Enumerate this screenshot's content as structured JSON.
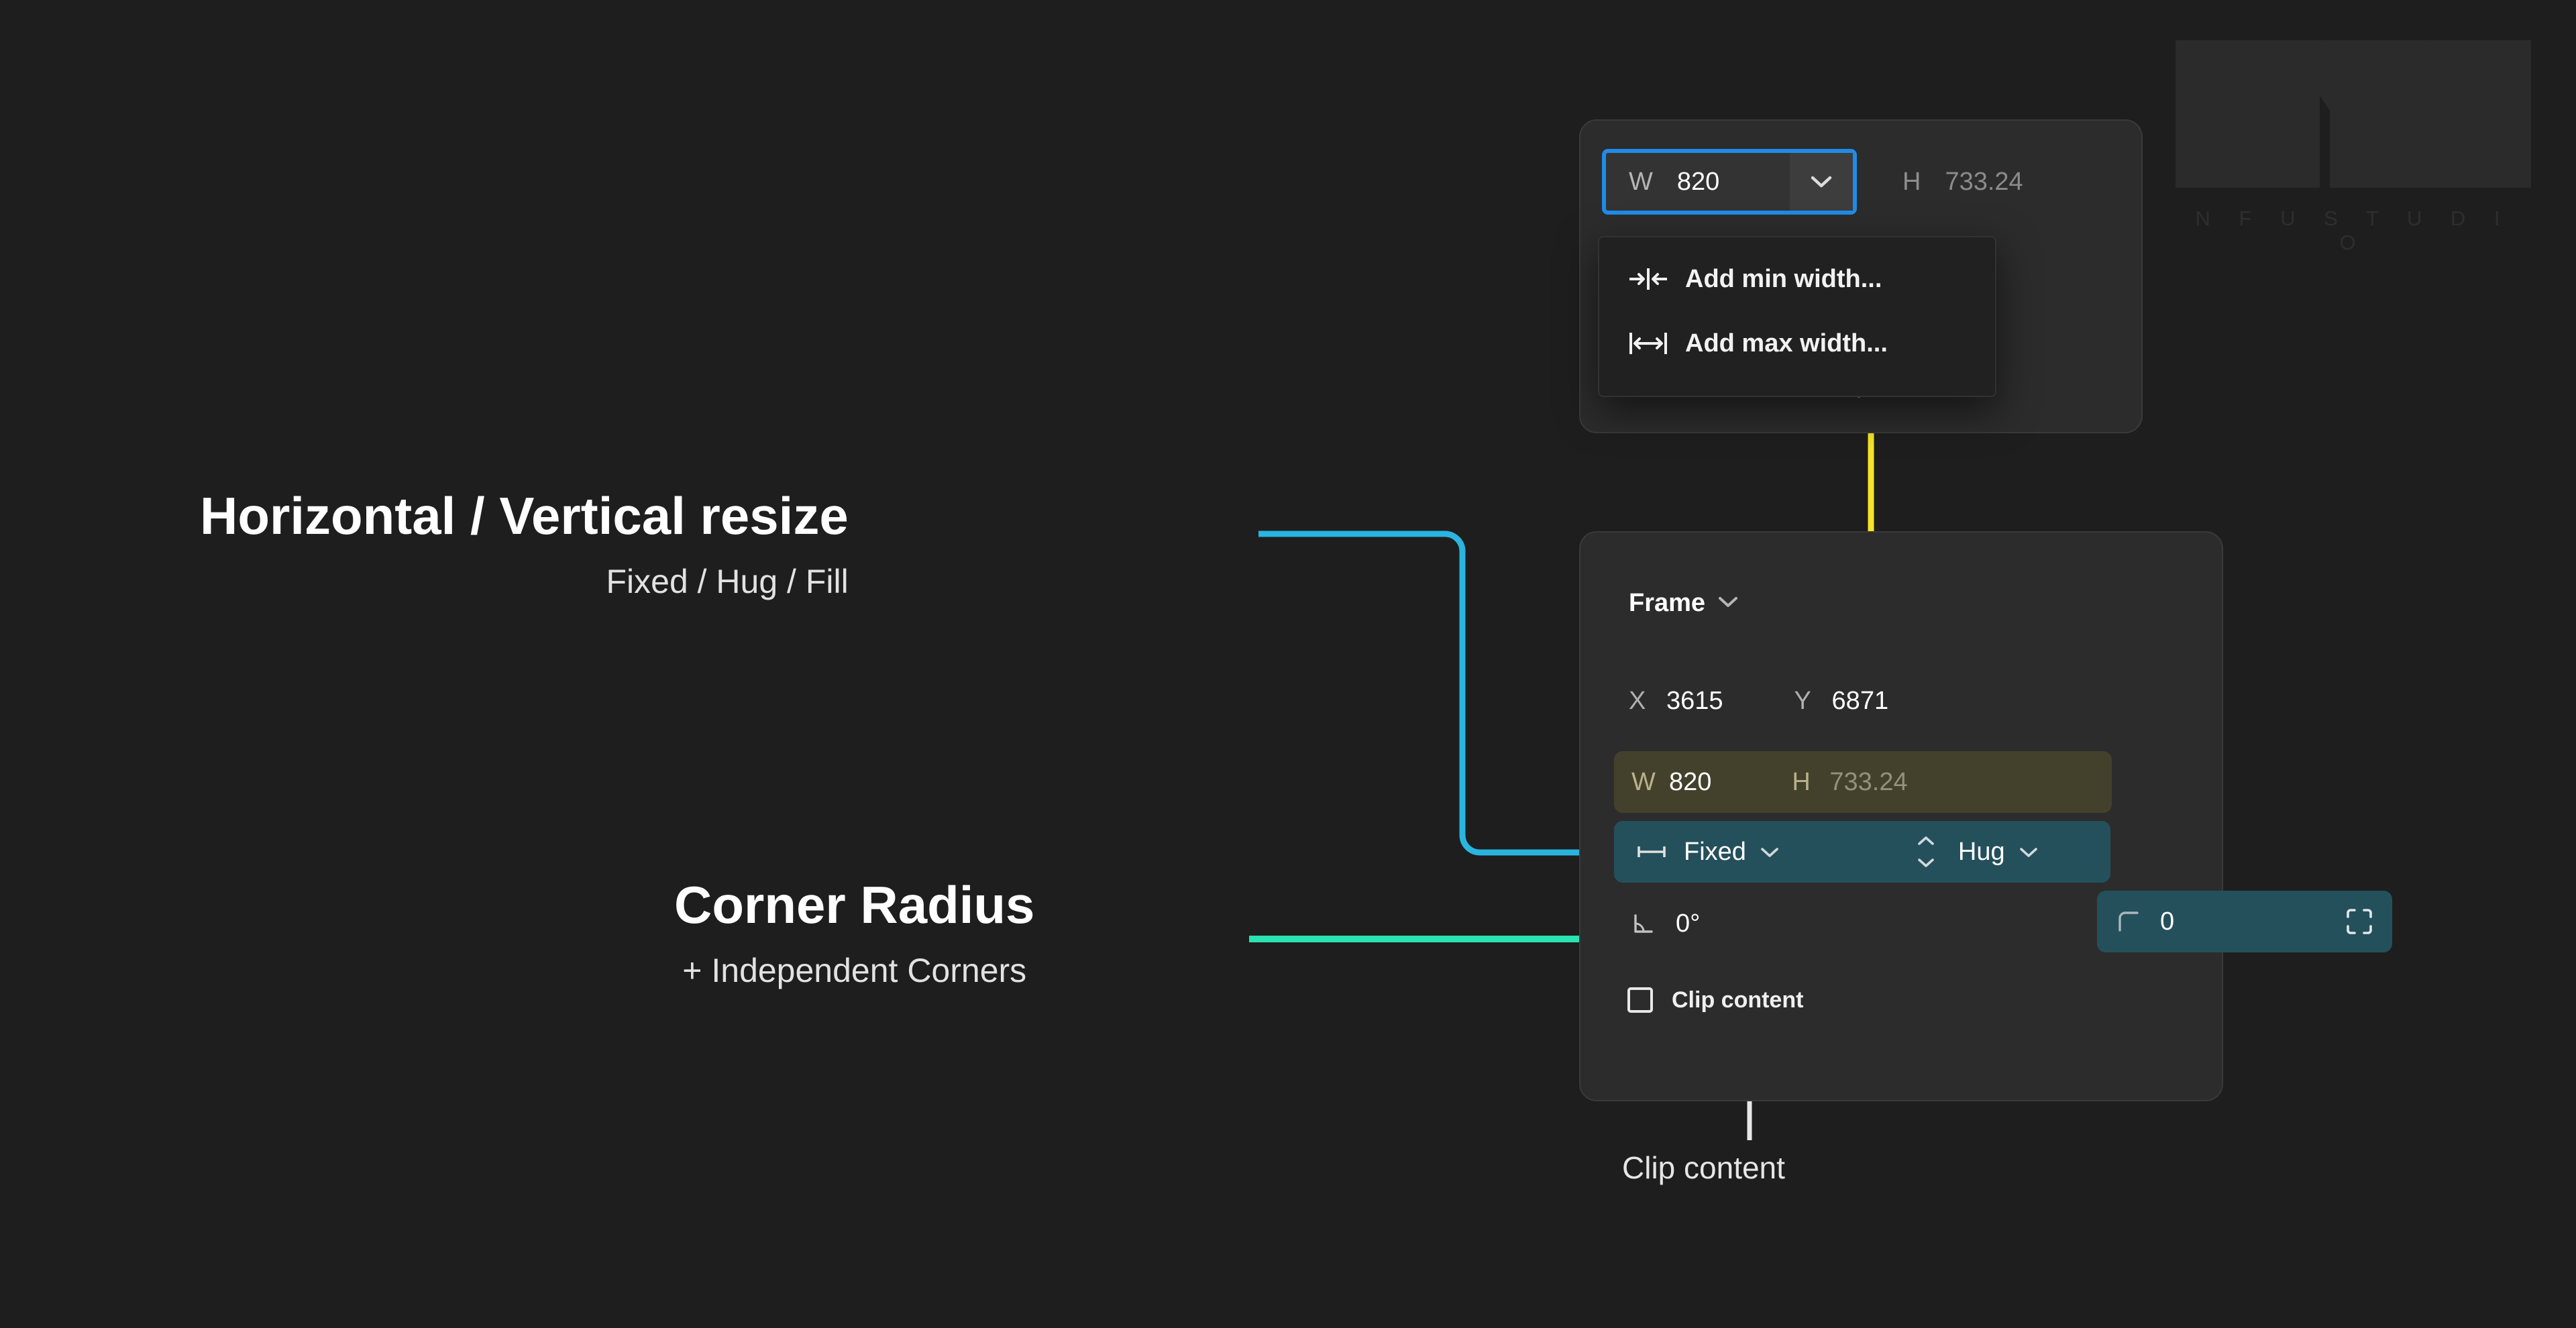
{
  "watermark": {
    "wordmark": "N F U   S T U D I O"
  },
  "colors": {
    "page_bg": "#1e1e1e",
    "panel_bg": "#2c2c2c",
    "accent_blue": "#1f8ce8",
    "accent_yellow": "#f5e42a",
    "accent_cyan": "#27c6d9",
    "accent_teal": "#2ae3b0",
    "highlight_teal_fill": "#24505c",
    "highlight_yellow_fill": "rgba(214,200,50,0.14)"
  },
  "top_panel": {
    "width_field": {
      "key": "W",
      "value": "820",
      "chevron": "chevron-down-icon"
    },
    "height_field": {
      "key": "H",
      "value": "733.24"
    },
    "hidden_row_chevron": "chevron-down-icon"
  },
  "dropdown_menu": {
    "items": [
      {
        "icon": "min-width-icon",
        "glyph": "→|←",
        "label": "Add min width..."
      },
      {
        "icon": "max-width-icon",
        "glyph": "|↔|",
        "label": "Add max width..."
      }
    ]
  },
  "main_panel": {
    "header": {
      "label": "Frame",
      "chevron": "chevron-down-icon"
    },
    "position": {
      "x_key": "X",
      "x_value": "3615",
      "y_key": "Y",
      "y_value": "6871"
    },
    "size": {
      "w_key": "W",
      "w_value": "820",
      "h_key": "H",
      "h_value": "733.24"
    },
    "resize": {
      "horizontal": {
        "icon": "horizontal-resize-icon",
        "value": "Fixed",
        "chevron": "chevron-down-icon"
      },
      "vertical": {
        "icon": "vertical-resize-icon",
        "value": "Hug",
        "chevron": "chevron-down-icon"
      }
    },
    "rotation": {
      "icon": "rotation-angle-icon",
      "value": "0°"
    },
    "corner_radius": {
      "icon": "corner-radius-icon",
      "value": "0",
      "independent_icon": "independent-corners-icon"
    },
    "clip": {
      "label": "Clip content",
      "checked": false
    }
  },
  "annotations": {
    "resize": {
      "title": "Horizontal / Vertical resize",
      "subtitle": "Fixed / Hug / Fill"
    },
    "radius": {
      "title": "Corner Radius",
      "subtitle": "+ Independent Corners"
    },
    "clip": {
      "label": "Clip content"
    }
  }
}
